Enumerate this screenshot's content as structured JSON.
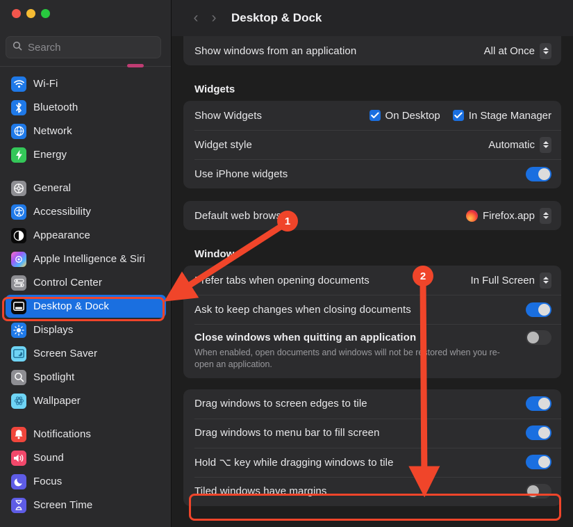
{
  "window": {
    "traffic_lights": [
      "close",
      "minimize",
      "zoom"
    ],
    "colors": {
      "accent": "#1a6fe0",
      "annotation": "#f0452a",
      "selected_row": "#1a6fe0"
    }
  },
  "search": {
    "placeholder": "Search",
    "icon": "search-icon"
  },
  "sidebar": {
    "groups": [
      {
        "items": [
          {
            "label": "Wi-Fi",
            "icon": "wifi-icon",
            "icon_class": "ic-blue",
            "selected": false
          },
          {
            "label": "Bluetooth",
            "icon": "bluetooth-icon",
            "icon_class": "ic-blue",
            "selected": false
          },
          {
            "label": "Network",
            "icon": "globe-icon",
            "icon_class": "ic-blue",
            "selected": false
          },
          {
            "label": "Energy",
            "icon": "bolt-icon",
            "icon_class": "ic-green",
            "selected": false
          }
        ]
      },
      {
        "items": [
          {
            "label": "General",
            "icon": "gear-icon",
            "icon_class": "ic-grey",
            "selected": false
          },
          {
            "label": "Accessibility",
            "icon": "accessibility-icon",
            "icon_class": "ic-blue",
            "selected": false
          },
          {
            "label": "Appearance",
            "icon": "appearance-icon",
            "icon_class": "ic-black",
            "selected": false
          },
          {
            "label": "Apple Intelligence & Siri",
            "icon": "siri-icon",
            "icon_class": "ic-ai",
            "selected": false
          },
          {
            "label": "Control Center",
            "icon": "control-center-icon",
            "icon_class": "ic-grey",
            "selected": false
          },
          {
            "label": "Desktop & Dock",
            "icon": "desktop-dock-icon",
            "icon_class": "ic-black",
            "selected": true
          },
          {
            "label": "Displays",
            "icon": "brightness-icon",
            "icon_class": "ic-blue",
            "selected": false
          },
          {
            "label": "Screen Saver",
            "icon": "screen-saver-icon",
            "icon_class": "ic-cyan",
            "selected": false
          },
          {
            "label": "Spotlight",
            "icon": "spotlight-icon",
            "icon_class": "ic-grey",
            "selected": false
          },
          {
            "label": "Wallpaper",
            "icon": "wallpaper-icon",
            "icon_class": "ic-cyan",
            "selected": false
          }
        ]
      },
      {
        "items": [
          {
            "label": "Notifications",
            "icon": "bell-icon",
            "icon_class": "ic-red",
            "selected": false
          },
          {
            "label": "Sound",
            "icon": "speaker-icon",
            "icon_class": "ic-pink",
            "selected": false
          },
          {
            "label": "Focus",
            "icon": "moon-icon",
            "icon_class": "ic-purple",
            "selected": false
          },
          {
            "label": "Screen Time",
            "icon": "hourglass-icon",
            "icon_class": "ic-purple",
            "selected": false
          }
        ]
      }
    ]
  },
  "header": {
    "back_icon": "chevron-left-icon",
    "forward_icon": "chevron-right-icon",
    "title": "Desktop & Dock"
  },
  "main": {
    "mission_control_card": {
      "rows": [
        {
          "label": "Show windows from an application",
          "control": "popup",
          "value": "All at Once"
        }
      ]
    },
    "widgets": {
      "section_title": "Widgets",
      "rows": [
        {
          "label": "Show Widgets",
          "control": "checkboxes",
          "checkboxes": [
            {
              "label": "On Desktop",
              "checked": true
            },
            {
              "label": "In Stage Manager",
              "checked": true
            }
          ]
        },
        {
          "label": "Widget style",
          "control": "popup",
          "value": "Automatic"
        },
        {
          "label": "Use iPhone widgets",
          "control": "toggle",
          "on": true
        }
      ]
    },
    "default_browser": {
      "rows": [
        {
          "label": "Default web browser",
          "control": "popup",
          "value": "Firefox.app",
          "icon": "firefox-icon"
        }
      ]
    },
    "windows": {
      "section_title": "Windows",
      "rows": [
        {
          "label": "Prefer tabs when opening documents",
          "control": "popup",
          "value": "In Full Screen"
        },
        {
          "label": "Ask to keep changes when closing documents",
          "control": "toggle",
          "on": true
        },
        {
          "label": "Close windows when quitting an application",
          "control": "toggle",
          "on": false,
          "description": "When enabled, open documents and windows will not be restored when you re-open an application."
        }
      ]
    },
    "tiling": {
      "rows": [
        {
          "label": "Drag windows to screen edges to tile",
          "control": "toggle",
          "on": true
        },
        {
          "label": "Drag windows to menu bar to fill screen",
          "control": "toggle",
          "on": true
        },
        {
          "label": "Hold ⌥ key while dragging windows to tile",
          "control": "toggle",
          "on": true
        },
        {
          "label": "Tiled windows have margins",
          "control": "toggle",
          "on": false,
          "highlighted": true
        }
      ]
    }
  },
  "annotations": [
    {
      "number": "1",
      "type": "arrow",
      "target": "sidebar-item-desktop-dock"
    },
    {
      "number": "2",
      "type": "arrow",
      "target": "row-tiled-windows-have-margins"
    }
  ]
}
